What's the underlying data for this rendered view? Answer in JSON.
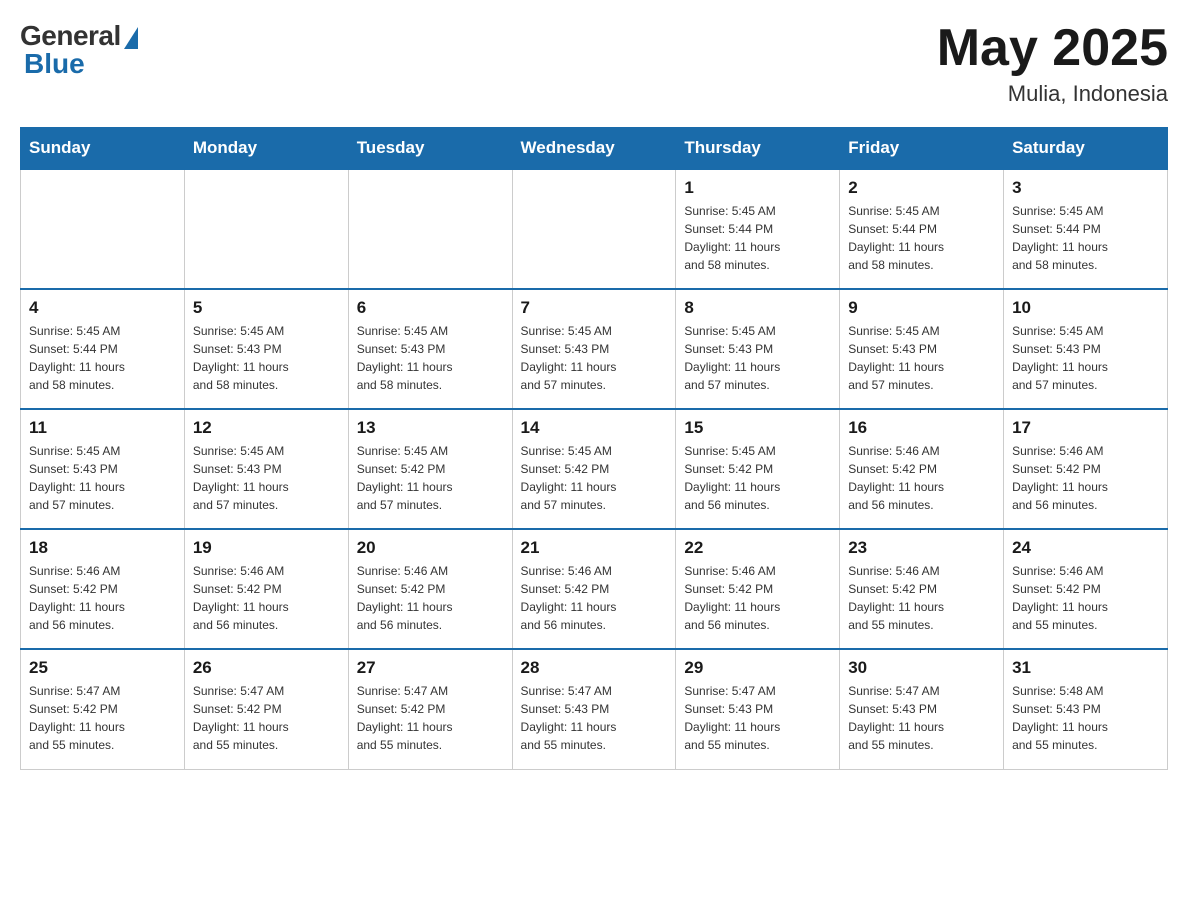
{
  "header": {
    "logo_general": "General",
    "logo_blue": "Blue",
    "month_year": "May 2025",
    "location": "Mulia, Indonesia"
  },
  "weekdays": [
    "Sunday",
    "Monday",
    "Tuesday",
    "Wednesday",
    "Thursday",
    "Friday",
    "Saturday"
  ],
  "weeks": [
    [
      {
        "day": "",
        "info": ""
      },
      {
        "day": "",
        "info": ""
      },
      {
        "day": "",
        "info": ""
      },
      {
        "day": "",
        "info": ""
      },
      {
        "day": "1",
        "info": "Sunrise: 5:45 AM\nSunset: 5:44 PM\nDaylight: 11 hours\nand 58 minutes."
      },
      {
        "day": "2",
        "info": "Sunrise: 5:45 AM\nSunset: 5:44 PM\nDaylight: 11 hours\nand 58 minutes."
      },
      {
        "day": "3",
        "info": "Sunrise: 5:45 AM\nSunset: 5:44 PM\nDaylight: 11 hours\nand 58 minutes."
      }
    ],
    [
      {
        "day": "4",
        "info": "Sunrise: 5:45 AM\nSunset: 5:44 PM\nDaylight: 11 hours\nand 58 minutes."
      },
      {
        "day": "5",
        "info": "Sunrise: 5:45 AM\nSunset: 5:43 PM\nDaylight: 11 hours\nand 58 minutes."
      },
      {
        "day": "6",
        "info": "Sunrise: 5:45 AM\nSunset: 5:43 PM\nDaylight: 11 hours\nand 58 minutes."
      },
      {
        "day": "7",
        "info": "Sunrise: 5:45 AM\nSunset: 5:43 PM\nDaylight: 11 hours\nand 57 minutes."
      },
      {
        "day": "8",
        "info": "Sunrise: 5:45 AM\nSunset: 5:43 PM\nDaylight: 11 hours\nand 57 minutes."
      },
      {
        "day": "9",
        "info": "Sunrise: 5:45 AM\nSunset: 5:43 PM\nDaylight: 11 hours\nand 57 minutes."
      },
      {
        "day": "10",
        "info": "Sunrise: 5:45 AM\nSunset: 5:43 PM\nDaylight: 11 hours\nand 57 minutes."
      }
    ],
    [
      {
        "day": "11",
        "info": "Sunrise: 5:45 AM\nSunset: 5:43 PM\nDaylight: 11 hours\nand 57 minutes."
      },
      {
        "day": "12",
        "info": "Sunrise: 5:45 AM\nSunset: 5:43 PM\nDaylight: 11 hours\nand 57 minutes."
      },
      {
        "day": "13",
        "info": "Sunrise: 5:45 AM\nSunset: 5:42 PM\nDaylight: 11 hours\nand 57 minutes."
      },
      {
        "day": "14",
        "info": "Sunrise: 5:45 AM\nSunset: 5:42 PM\nDaylight: 11 hours\nand 57 minutes."
      },
      {
        "day": "15",
        "info": "Sunrise: 5:45 AM\nSunset: 5:42 PM\nDaylight: 11 hours\nand 56 minutes."
      },
      {
        "day": "16",
        "info": "Sunrise: 5:46 AM\nSunset: 5:42 PM\nDaylight: 11 hours\nand 56 minutes."
      },
      {
        "day": "17",
        "info": "Sunrise: 5:46 AM\nSunset: 5:42 PM\nDaylight: 11 hours\nand 56 minutes."
      }
    ],
    [
      {
        "day": "18",
        "info": "Sunrise: 5:46 AM\nSunset: 5:42 PM\nDaylight: 11 hours\nand 56 minutes."
      },
      {
        "day": "19",
        "info": "Sunrise: 5:46 AM\nSunset: 5:42 PM\nDaylight: 11 hours\nand 56 minutes."
      },
      {
        "day": "20",
        "info": "Sunrise: 5:46 AM\nSunset: 5:42 PM\nDaylight: 11 hours\nand 56 minutes."
      },
      {
        "day": "21",
        "info": "Sunrise: 5:46 AM\nSunset: 5:42 PM\nDaylight: 11 hours\nand 56 minutes."
      },
      {
        "day": "22",
        "info": "Sunrise: 5:46 AM\nSunset: 5:42 PM\nDaylight: 11 hours\nand 56 minutes."
      },
      {
        "day": "23",
        "info": "Sunrise: 5:46 AM\nSunset: 5:42 PM\nDaylight: 11 hours\nand 55 minutes."
      },
      {
        "day": "24",
        "info": "Sunrise: 5:46 AM\nSunset: 5:42 PM\nDaylight: 11 hours\nand 55 minutes."
      }
    ],
    [
      {
        "day": "25",
        "info": "Sunrise: 5:47 AM\nSunset: 5:42 PM\nDaylight: 11 hours\nand 55 minutes."
      },
      {
        "day": "26",
        "info": "Sunrise: 5:47 AM\nSunset: 5:42 PM\nDaylight: 11 hours\nand 55 minutes."
      },
      {
        "day": "27",
        "info": "Sunrise: 5:47 AM\nSunset: 5:42 PM\nDaylight: 11 hours\nand 55 minutes."
      },
      {
        "day": "28",
        "info": "Sunrise: 5:47 AM\nSunset: 5:43 PM\nDaylight: 11 hours\nand 55 minutes."
      },
      {
        "day": "29",
        "info": "Sunrise: 5:47 AM\nSunset: 5:43 PM\nDaylight: 11 hours\nand 55 minutes."
      },
      {
        "day": "30",
        "info": "Sunrise: 5:47 AM\nSunset: 5:43 PM\nDaylight: 11 hours\nand 55 minutes."
      },
      {
        "day": "31",
        "info": "Sunrise: 5:48 AM\nSunset: 5:43 PM\nDaylight: 11 hours\nand 55 minutes."
      }
    ]
  ]
}
